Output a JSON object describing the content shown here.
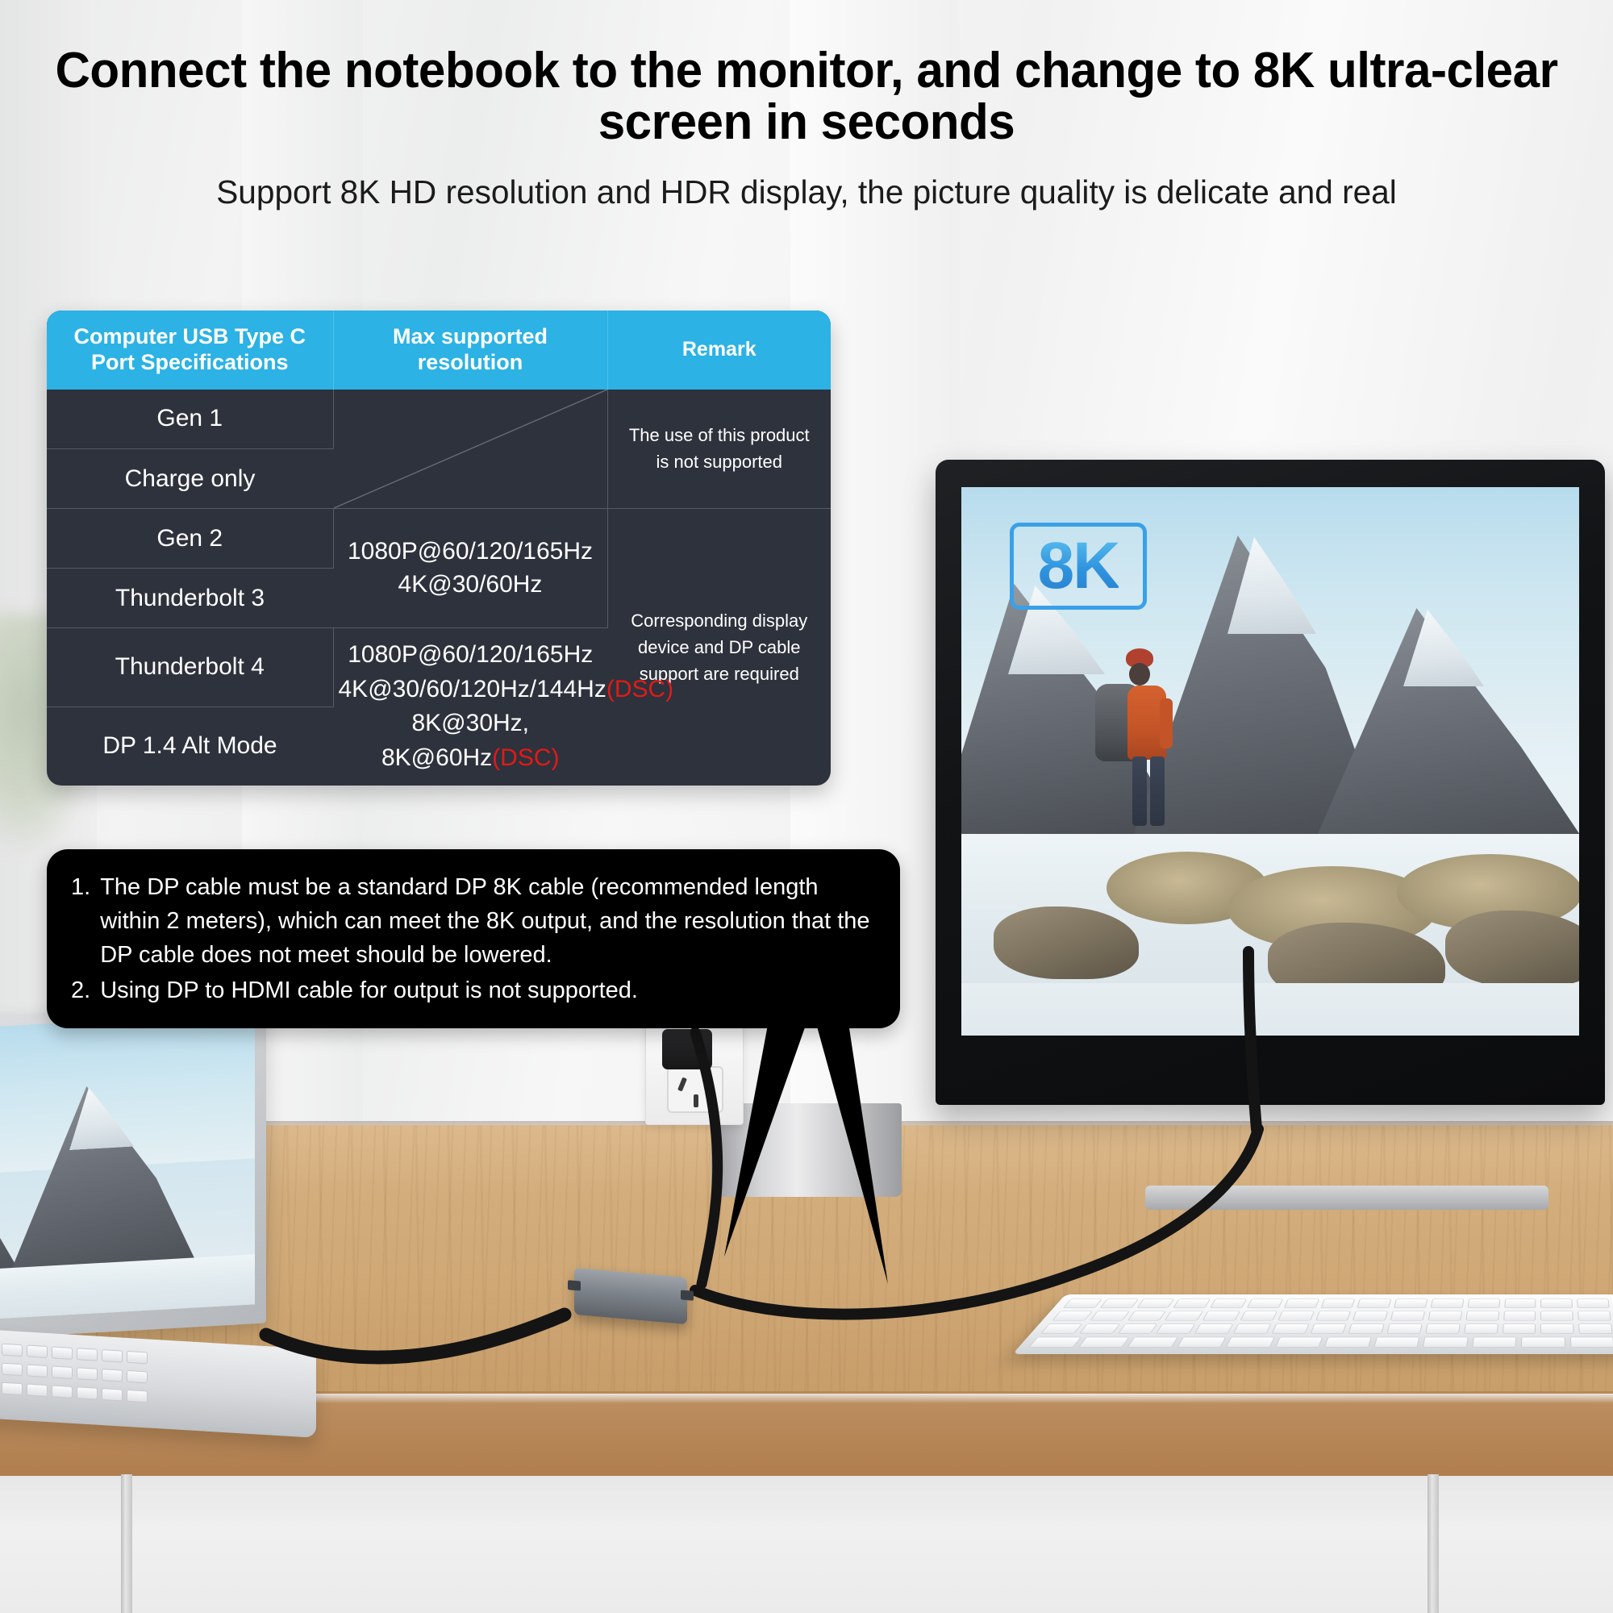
{
  "heading": {
    "title": "Connect the notebook to the monitor, and change to 8K ultra-clear screen in seconds",
    "subtitle": "Support 8K HD resolution and HDR display, the picture quality is delicate and real"
  },
  "colors": {
    "table_header_blue": "#2cb2e4",
    "table_body_dark": "#2e323c",
    "dsc_red": "#e01b17",
    "callout_black": "#000000",
    "badge_blue": "#3aa0e8"
  },
  "spec_table": {
    "headers": [
      "Computer USB Type C Port Specifications",
      "Max supported resolution",
      "Remark"
    ],
    "header_lines": {
      "col1": [
        "Computer USB Type C",
        "Port Specifications"
      ],
      "col2": [
        "Max supported",
        "resolution"
      ],
      "col3": [
        "Remark"
      ]
    },
    "rows": [
      {
        "spec": "Gen 1"
      },
      {
        "spec": "Charge only"
      },
      {
        "spec": "Gen 2"
      },
      {
        "spec": "Thunderbolt 3"
      },
      {
        "spec": "Thunderbolt 4"
      },
      {
        "spec": "DP  1.4 Alt Mode"
      }
    ],
    "resolution_group_a": [
      "1080P@60/120/165Hz",
      "4K@30/60Hz"
    ],
    "resolution_group_b": {
      "line1": "1080P@60/120/165Hz",
      "line2_main": "4K@30/60/120Hz/144Hz",
      "line2_tag": "(DSC)",
      "line3_main": "8K@30Hz, 8K@60Hz",
      "line3_tag": "(DSC)"
    },
    "remark_unsupported": [
      "The use of this product",
      "is not supported"
    ],
    "remark_supported": [
      "Corresponding display",
      "device and DP cable",
      "support are required"
    ],
    "na_cell_label": "not applicable"
  },
  "callout": {
    "items": [
      {
        "num": "1.",
        "text": "The DP cable must be a standard DP 8K cable (recommended length within 2 meters), which can meet the 8K output, and the resolution that the DP cable does not meet should be lowered."
      },
      {
        "num": "2.",
        "text": "Using DP to HDMI cable for output is not supported."
      }
    ]
  },
  "scene": {
    "monitor_badge": "8K",
    "hub_brand": "",
    "monitor_label": "",
    "laptop_label": ""
  }
}
